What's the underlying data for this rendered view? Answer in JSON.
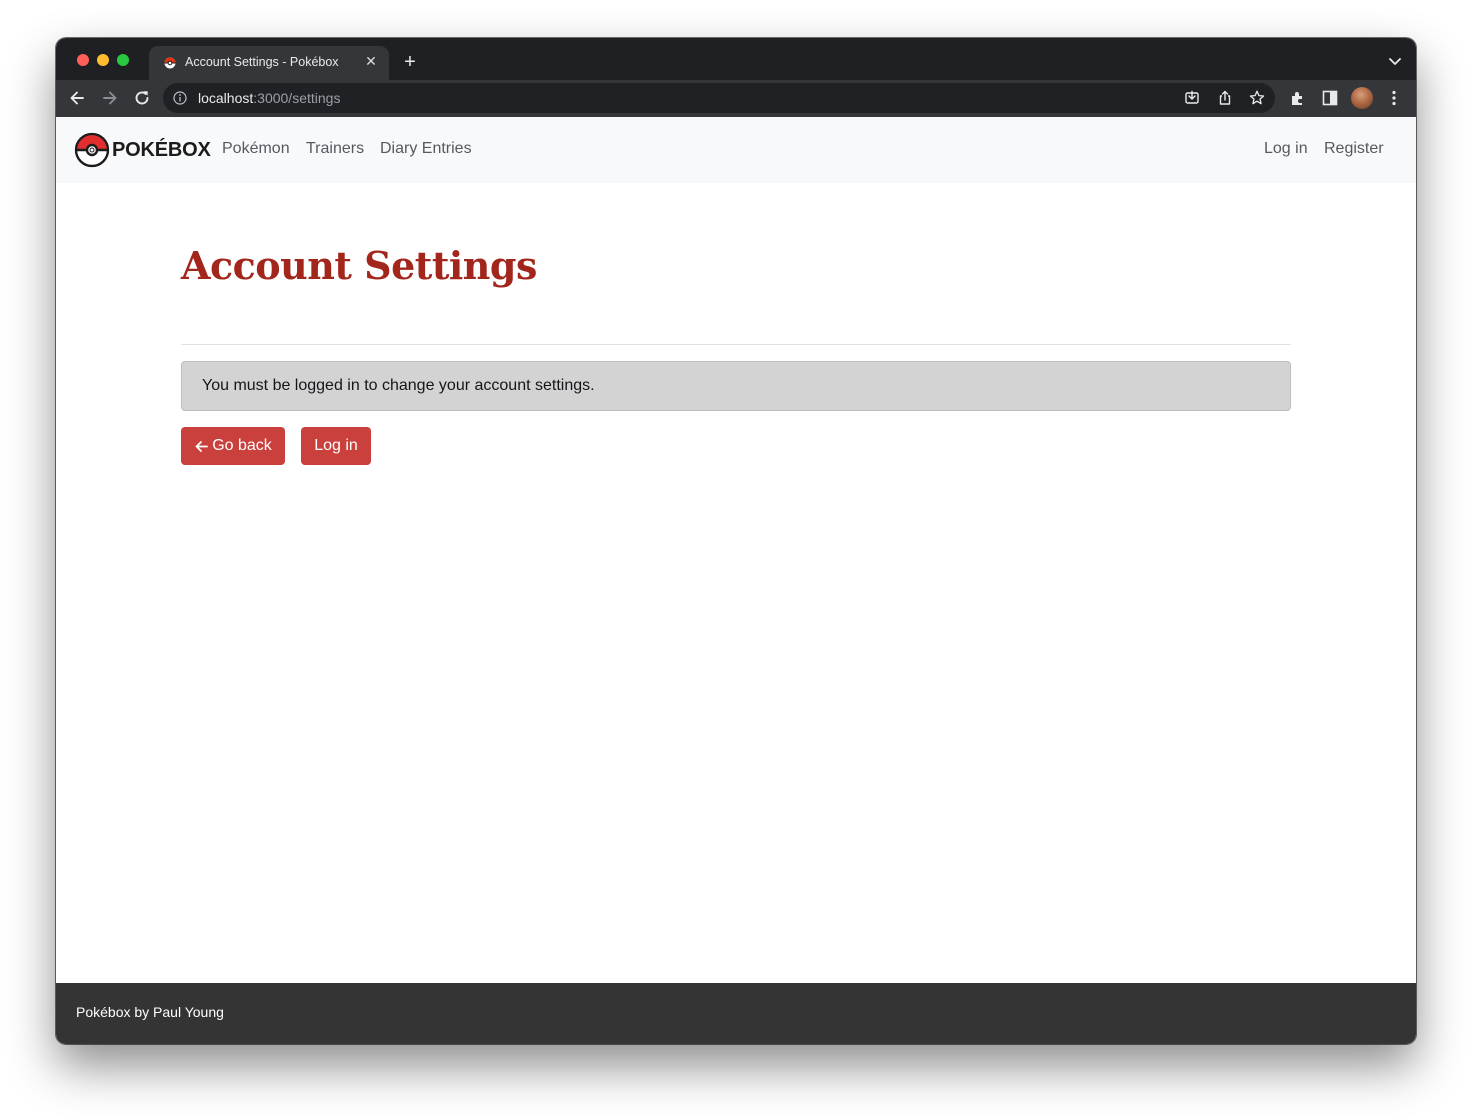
{
  "browser": {
    "tab": {
      "title": "Account Settings - Pokébox",
      "close_glyph": "✕",
      "favicon": "pokeball-icon"
    },
    "new_tab_glyph": "+",
    "address": {
      "host": "localhost",
      "path": ":3000/settings"
    },
    "icons": [
      "back-icon",
      "forward-icon",
      "reload-icon",
      "site-info-icon",
      "install-icon",
      "share-icon",
      "bookmark-star-icon",
      "extensions-icon",
      "side-panel-icon",
      "profile-avatar",
      "menu-kebab-icon",
      "tab-search-chevron-icon"
    ]
  },
  "navbar": {
    "brand": "POKÉBOX",
    "links": [
      "Pokémon",
      "Trainers",
      "Diary Entries"
    ],
    "auth": {
      "login": "Log in",
      "register": "Register"
    }
  },
  "main": {
    "title": "Account Settings",
    "alert": "You must be logged in to change your account settings.",
    "buttons": {
      "back": "Go back",
      "login": "Log in"
    }
  },
  "footer": {
    "text": "Pokébox by Paul Young"
  },
  "colors": {
    "brand_red": "#a3261c",
    "button_red": "#c9403d",
    "alert_bg": "#d3d3d4",
    "footer_bg": "#343434",
    "chrome_dark": "#1f2023"
  }
}
